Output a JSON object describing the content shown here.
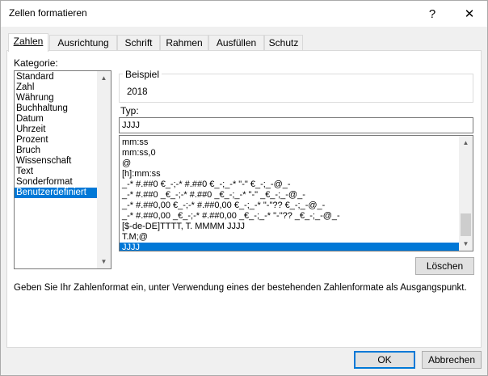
{
  "window": {
    "title": "Zellen formatieren",
    "help_glyph": "?",
    "close_glyph": "✕"
  },
  "tabs": [
    {
      "label": "Zahlen",
      "active": true
    },
    {
      "label": "Ausrichtung",
      "active": false
    },
    {
      "label": "Schrift",
      "active": false
    },
    {
      "label": "Rahmen",
      "active": false
    },
    {
      "label": "Ausfüllen",
      "active": false
    },
    {
      "label": "Schutz",
      "active": false
    }
  ],
  "category": {
    "label": "Kategorie:",
    "items": [
      "Standard",
      "Zahl",
      "Währung",
      "Buchhaltung",
      "Datum",
      "Uhrzeit",
      "Prozent",
      "Bruch",
      "Wissenschaft",
      "Text",
      "Sonderformat",
      "Benutzerdefiniert"
    ],
    "selected": "Benutzerdefiniert"
  },
  "sample": {
    "label": "Beispiel",
    "value": "2018"
  },
  "type": {
    "label": "Typ:",
    "value": "JJJJ"
  },
  "format_list": {
    "items": [
      "mm:ss",
      "mm:ss,0",
      "@",
      "[h]:mm:ss",
      "_-* #.##0 €_-;-* #.##0 €_-;_-* \"-\" €_-;_-@_-",
      "_-* #.##0 _€_-;-* #.##0 _€_-;_-* \"-\" _€_-;_-@_-",
      "_-* #.##0,00 €_-;-* #.##0,00 €_-;_-* \"-\"?? €_-;_-@_-",
      "_-* #.##0,00 _€_-;-* #.##0,00 _€_-;_-* \"-\"?? _€_-;_-@_-",
      "[$-de-DE]TTTT, T. MMMM JJJJ",
      "T.M;@",
      "JJJJ"
    ],
    "selected": "JJJJ"
  },
  "buttons": {
    "delete": "Löschen",
    "ok": "OK",
    "cancel": "Abbrechen"
  },
  "hint": "Geben Sie Ihr Zahlenformat ein, unter Verwendung eines der bestehenden Zahlenformate als Ausgangspunkt.",
  "colors": {
    "selection": "#0078d7",
    "dialog_bg": "#f0f0f0"
  }
}
